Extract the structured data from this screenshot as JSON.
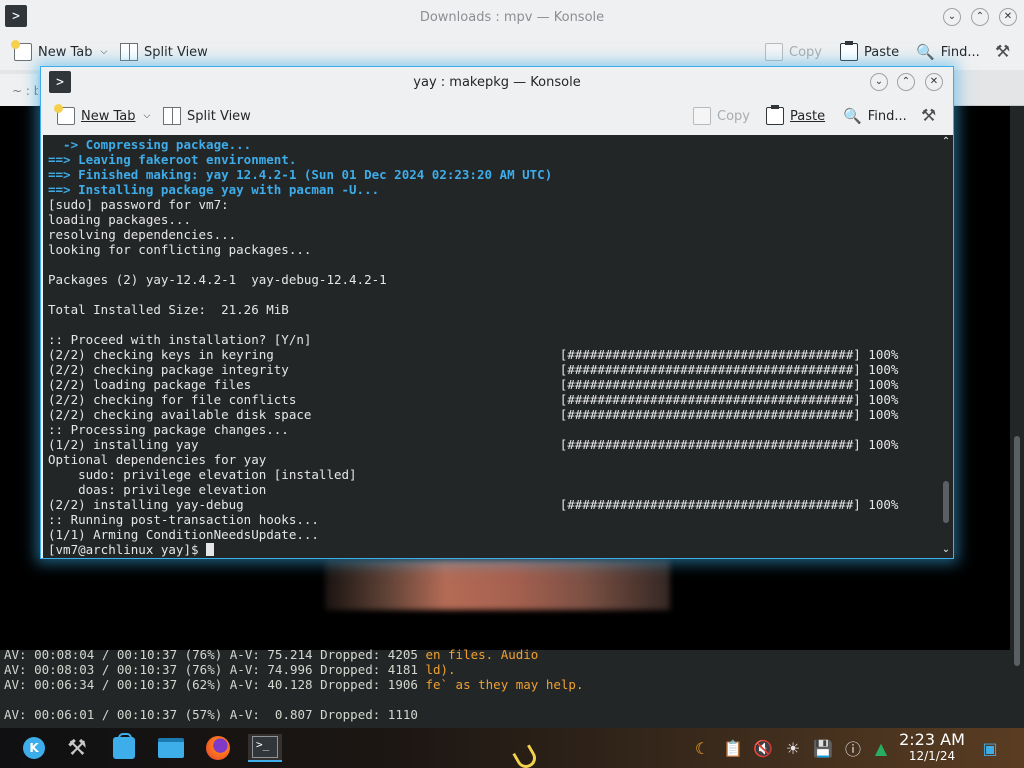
{
  "bg_window": {
    "title": "Downloads : mpv — Konsole",
    "app_icon": ">",
    "toolbar": {
      "new_tab": "New Tab",
      "split_view": "Split View",
      "copy": "Copy",
      "paste": "Paste",
      "find": "Find..."
    },
    "tab_label": "~ : b",
    "terminal_lines": [
      {
        "main": "AV: 00:08:04 / 00:10:37 (76%) A-V: 75.214 Dropped: 4205 ",
        "tail": "en files. Audio"
      },
      {
        "main": "AV: 00:08:03 / 00:10:37 (76%) A-V: 74.996 Dropped: 4181 ",
        "tail": "ld)."
      },
      {
        "main": "AV: 00:06:34 / 00:10:37 (62%) A-V: 40.128 Dropped: 1906 ",
        "tail": "fe` as they may help."
      },
      {
        "main": "",
        "tail": ""
      },
      {
        "main": "AV: 00:06:01 / 00:10:37 (57%) A-V:  0.807 Dropped: 1110",
        "tail": ""
      }
    ]
  },
  "fg_window": {
    "title": "yay : makepkg — Konsole",
    "app_icon": ">",
    "toolbar": {
      "new_tab": "New Tab",
      "split_view": "Split View",
      "copy": "Copy",
      "paste": "Paste",
      "find": "Find..."
    },
    "terminal_lines": [
      {
        "text": "  -> Compressing package...",
        "style": "cyan"
      },
      {
        "text": "==> Leaving fakeroot environment.",
        "style": "cyan"
      },
      {
        "text": "==> Finished making: yay 12.4.2-1 (Sun 01 Dec 2024 02:23:20 AM UTC)",
        "style": "cyan"
      },
      {
        "text": "==> Installing package yay with pacman -U...",
        "style": "cyan"
      },
      {
        "text": "[sudo] password for vm7:",
        "style": "plain"
      },
      {
        "text": "loading packages...",
        "style": "plain"
      },
      {
        "text": "resolving dependencies...",
        "style": "plain"
      },
      {
        "text": "looking for conflicting packages...",
        "style": "plain"
      },
      {
        "text": "",
        "style": "plain"
      },
      {
        "text": "Packages (2) yay-12.4.2-1  yay-debug-12.4.2-1",
        "style": "plain"
      },
      {
        "text": "",
        "style": "plain"
      },
      {
        "text": "Total Installed Size:  21.26 MiB",
        "style": "plain"
      },
      {
        "text": "",
        "style": "plain"
      },
      {
        "text": ":: Proceed with installation? [Y/n]",
        "style": "plain"
      },
      {
        "text": "(2/2) checking keys in keyring                                      [######################################] 100%",
        "style": "plain"
      },
      {
        "text": "(2/2) checking package integrity                                    [######################################] 100%",
        "style": "plain"
      },
      {
        "text": "(2/2) loading package files                                         [######################################] 100%",
        "style": "plain"
      },
      {
        "text": "(2/2) checking for file conflicts                                   [######################################] 100%",
        "style": "plain"
      },
      {
        "text": "(2/2) checking available disk space                                 [######################################] 100%",
        "style": "plain"
      },
      {
        "text": ":: Processing package changes...",
        "style": "plain"
      },
      {
        "text": "(1/2) installing yay                                                [######################################] 100%",
        "style": "plain"
      },
      {
        "text": "Optional dependencies for yay",
        "style": "plain"
      },
      {
        "text": "    sudo: privilege elevation [installed]",
        "style": "plain"
      },
      {
        "text": "    doas: privilege elevation",
        "style": "plain"
      },
      {
        "text": "(2/2) installing yay-debug                                          [######################################] 100%",
        "style": "plain"
      },
      {
        "text": ":: Running post-transaction hooks...",
        "style": "plain"
      },
      {
        "text": "(1/1) Arming ConditionNeedsUpdate...",
        "style": "plain"
      }
    ],
    "prompt": "[vm7@archlinux yay]$ "
  },
  "taskbar": {
    "launcher_label": "K",
    "terminal_icon_text": ">_",
    "clock_time": "2:23 AM",
    "clock_date": "12/1/24"
  },
  "colors": {
    "accent": "#3daee9",
    "terminal_bg": "#232627",
    "titlebar_bg": "#eff0f1",
    "mpv_warning_text": "#f0a030"
  }
}
